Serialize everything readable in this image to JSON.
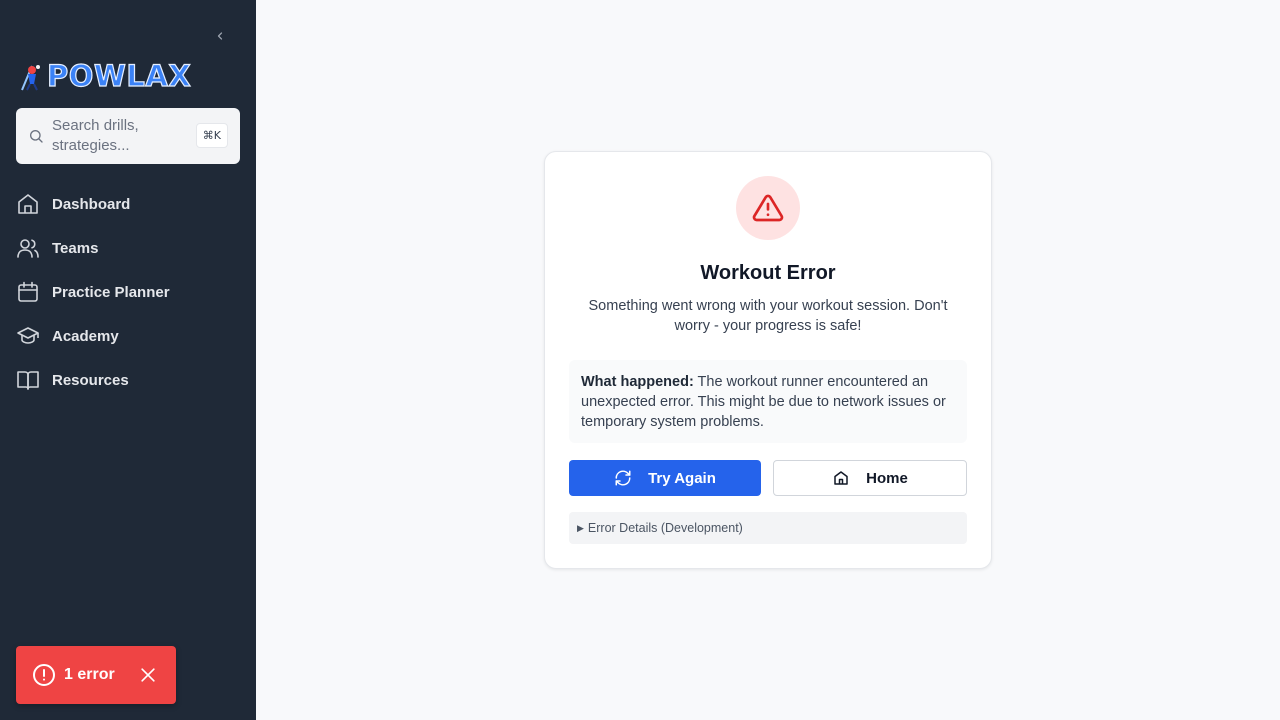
{
  "app": {
    "logo_text": "POWLAX"
  },
  "search": {
    "placeholder": "Search drills, strategies...",
    "shortcut": "⌘K"
  },
  "sidebar": {
    "items": [
      {
        "label": "Dashboard",
        "icon": "home-icon"
      },
      {
        "label": "Teams",
        "icon": "users-icon"
      },
      {
        "label": "Practice Planner",
        "icon": "calendar-icon"
      },
      {
        "label": "Academy",
        "icon": "graduation-cap-icon"
      },
      {
        "label": "Resources",
        "icon": "book-open-icon"
      }
    ]
  },
  "toast": {
    "label": "1 error",
    "color": "#ef4444"
  },
  "error_card": {
    "title": "Workout Error",
    "description": "Something went wrong with your workout session. Don't worry - your progress is safe!",
    "info_label": "What happened:",
    "info_text": " The workout runner encountered an unexpected error. This might be due to network issues or temporary system problems.",
    "try_again_label": "Try Again",
    "home_label": "Home",
    "details_label": "Error Details (Development)"
  },
  "colors": {
    "sidebar_bg": "#1f2937",
    "primary": "#2563eb",
    "danger": "#dc2626"
  }
}
